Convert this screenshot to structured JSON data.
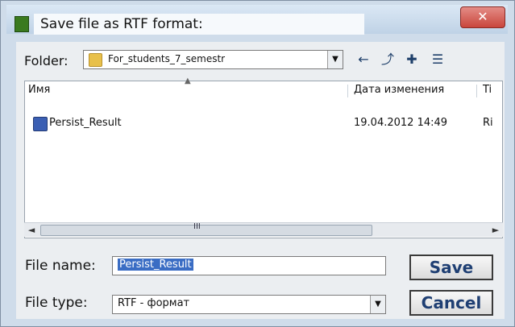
{
  "window": {
    "title": "Save file as RTF format:"
  },
  "folder": {
    "label": "Folder:",
    "current": "For_students_7_semestr"
  },
  "toolbar": {
    "back_icon": "arrow-left-icon",
    "up_icon": "folder-up-icon",
    "new_folder_icon": "new-folder-icon",
    "view_icon": "view-menu-icon"
  },
  "list": {
    "columns": {
      "name": "Имя",
      "date": "Дата изменения",
      "type": "Ti"
    },
    "rows": [
      {
        "name": "Persist_Result",
        "date": "19.04.2012 14:49",
        "type": "Ri"
      }
    ]
  },
  "scroll": {
    "left": "◄",
    "right": "►",
    "grip": "III"
  },
  "form": {
    "file_name_label": "File name:",
    "file_name_value": "Persist_Result",
    "file_type_label": "File type:",
    "file_type_value": "RTF - формат"
  },
  "buttons": {
    "save": "Save",
    "cancel": "Cancel"
  },
  "colors": {
    "selection": "#3a6dc4",
    "accent": "#1f3f73",
    "window_bg": "#cfdcea"
  }
}
